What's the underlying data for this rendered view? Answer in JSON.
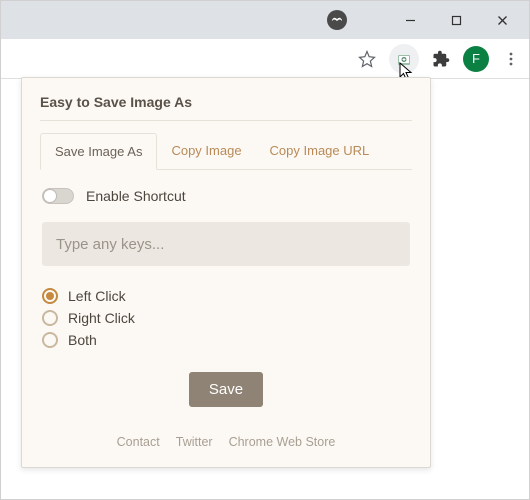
{
  "window": {
    "avatar_letter": "F"
  },
  "popup": {
    "title": "Easy to Save Image As",
    "tabs": [
      {
        "label": "Save Image As",
        "active": true
      },
      {
        "label": "Copy Image",
        "active": false
      },
      {
        "label": "Copy Image URL",
        "active": false
      }
    ],
    "enable_shortcut_label": "Enable Shortcut",
    "shortcut_on": false,
    "key_input_placeholder": "Type any keys...",
    "key_input_value": "",
    "options": [
      {
        "label": "Left Click",
        "selected": true
      },
      {
        "label": "Right Click",
        "selected": false
      },
      {
        "label": "Both",
        "selected": false
      }
    ],
    "save_label": "Save",
    "footer": {
      "contact": "Contact",
      "twitter": "Twitter",
      "webstore": "Chrome Web Store"
    }
  }
}
